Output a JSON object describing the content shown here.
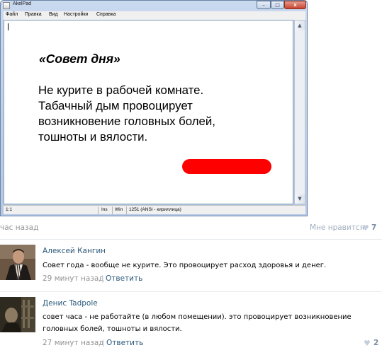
{
  "akelpad": {
    "title": "AkelPad",
    "window_buttons": {
      "minimize": "–",
      "maximize": "□",
      "close": "x"
    },
    "menu": [
      "Файл",
      "Правка",
      "Вид",
      "Настройки",
      "Справка"
    ],
    "document": {
      "heading": "«Совет дня»",
      "lines": [
        "Не курите в рабочей комнате.",
        "Табачный дым провоцирует",
        "возникновение головных болей,",
        "тошноты и вялости."
      ]
    },
    "scrollbar": {
      "up": "▲",
      "down": "▼"
    },
    "status": {
      "position": "1:1",
      "mode": "Ins",
      "newline": "Win",
      "encoding": "1251  (ANSI - кириллица)"
    }
  },
  "post": {
    "time": "час назад",
    "like_label": "Мне нравится",
    "like_count": "7",
    "heart_icon": "♥"
  },
  "comments": [
    {
      "author": "Алексей Кангин",
      "text": "Совет года - вообще не курите. Это провоцирует расход здоровья и денег.",
      "time": "29 минут назад",
      "separator": "|",
      "reply": "Ответить"
    },
    {
      "author": "Денис Tadpole",
      "text": "совет часа - не работайте (в любом помещении). это провоцирует возникновение головных болей, тошноты и вялости.",
      "time": "27 минут назад",
      "separator": "|",
      "reply": "Ответить",
      "like_count": "2",
      "heart_icon": "♥"
    }
  ],
  "colors": {
    "link": "#2b587a",
    "muted": "#939393",
    "redaction": "#ff0000"
  }
}
